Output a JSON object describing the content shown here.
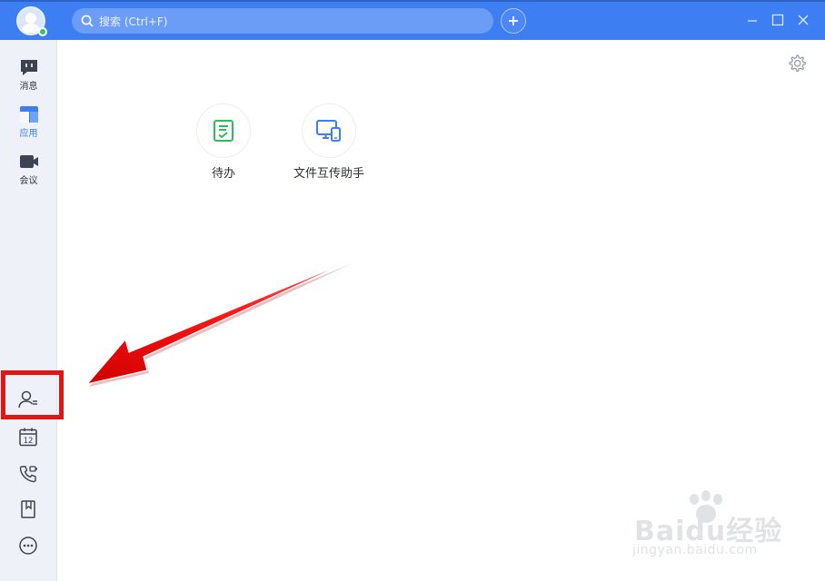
{
  "search": {
    "placeholder": "搜索 (Ctrl+F)"
  },
  "sidebar": {
    "items": [
      {
        "label": "消息",
        "icon": "message-icon"
      },
      {
        "label": "应用",
        "icon": "apps-icon",
        "active": true
      },
      {
        "label": "会议",
        "icon": "meeting-icon"
      }
    ],
    "tools": [
      {
        "icon": "contacts-icon",
        "highlighted": true
      },
      {
        "icon": "calendar-icon",
        "day": "12"
      },
      {
        "icon": "phone-call-icon"
      },
      {
        "icon": "bookmark-icon"
      },
      {
        "icon": "more-icon"
      }
    ]
  },
  "apps": [
    {
      "label": "待办",
      "icon": "todo-icon",
      "color": "#2ebd5a"
    },
    {
      "label": "文件互传助手",
      "icon": "file-transfer-icon",
      "color": "#3d7ef3"
    }
  ],
  "watermark": {
    "brand": "Baidu经验",
    "url": "jingyan.baidu.com"
  },
  "colors": {
    "accent": "#3d7ef3",
    "annotation": "#e31414",
    "online": "#2ec85a"
  }
}
